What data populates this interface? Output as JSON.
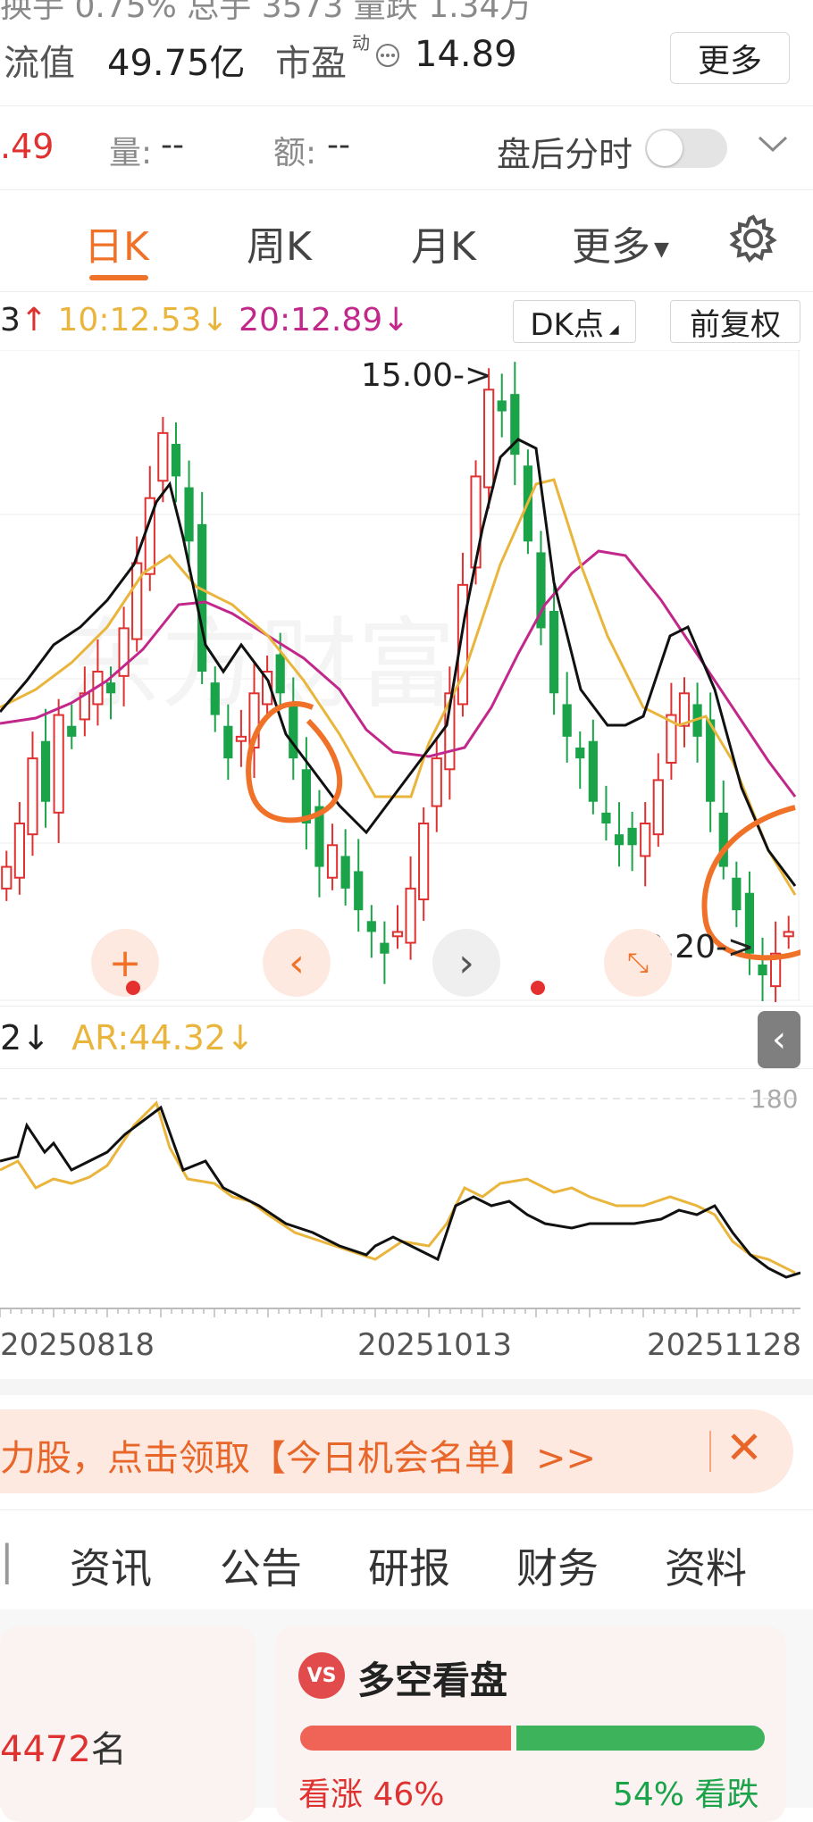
{
  "header": {
    "row0_partial": "换手  0.75%  总手  3573  量跌  1.34万",
    "circ_cap_label": "流值",
    "circ_cap_value": "49.75亿",
    "pe_label": "市盈",
    "pe_sup": "动",
    "pe_value": "14.89",
    "more_button": "更多"
  },
  "quote_row": {
    "price_partial": ".49",
    "vol_label": "量:",
    "vol_value": "--",
    "amount_label": "额:",
    "amount_value": "--",
    "after_hours_label": "盘后分时",
    "after_hours_on": false
  },
  "kline_tabs": [
    "日K",
    "周K",
    "月K",
    "更多"
  ],
  "kline_active_index": 0,
  "ma_row": {
    "ma5_partial": "3",
    "ma10": "10:12.53",
    "ma20": "20:12.89",
    "dk_button": "DK点",
    "adjust_button": "前复权"
  },
  "chart_annotations": {
    "high_label": "15.00->",
    "low_label": "12.20->"
  },
  "indicator_row": {
    "br_partial": "2",
    "ar": "AR:44.32",
    "level_180": "180"
  },
  "chart_data": {
    "type": "line",
    "x_tick_labels": [
      "20250818",
      "20251013",
      "20251128"
    ],
    "price_high": 15.0,
    "price_low": 12.2,
    "candles_close": [
      12.7,
      12.9,
      13.2,
      13.0,
      13.4,
      13.3,
      13.5,
      13.6,
      13.5,
      13.8,
      14.1,
      14.4,
      14.7,
      14.5,
      14.2,
      13.6,
      13.4,
      13.2,
      13.3,
      13.5,
      13.6,
      13.5,
      13.2,
      12.9,
      12.7,
      12.8,
      12.6,
      12.5,
      12.4,
      12.3,
      12.4,
      12.6,
      12.9,
      13.2,
      13.5,
      14.0,
      14.5,
      14.9,
      14.8,
      14.6,
      14.2,
      13.8,
      13.5,
      13.3,
      13.2,
      13.0,
      12.9,
      12.8,
      12.8,
      12.9,
      13.1,
      13.4,
      13.5,
      13.3,
      13.0,
      12.7,
      12.5,
      12.3,
      12.2,
      12.3,
      12.4
    ],
    "indicator_ar_note": "BRAR",
    "ar_last": 44.32
  },
  "chart_colors": {
    "up": "#e03131",
    "down": "#1ba34a",
    "ma5": "#111111",
    "ma10": "#e9b53c",
    "ma20": "#c2278b",
    "annotation_circle": "#f07228"
  },
  "banner": {
    "text": "力股，点击领取【今日机会名单】>>"
  },
  "info_tabs": [
    "资讯",
    "公告",
    "研报",
    "财务",
    "资料"
  ],
  "card_left": {
    "rank_value": "4472",
    "rank_unit": "名"
  },
  "card_right": {
    "logo": "VS",
    "title": "多空看盘",
    "bull_label": "看涨",
    "bull_pct": "46%",
    "bear_pct": "54%",
    "bear_label": "看跌",
    "bull_ratio": 0.46
  }
}
